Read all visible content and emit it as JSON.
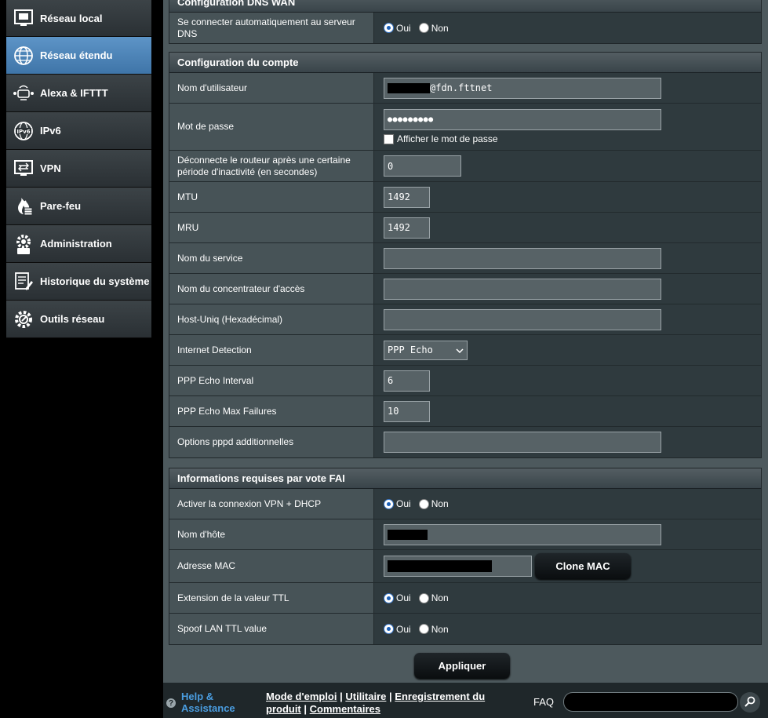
{
  "sidebar": {
    "items": [
      {
        "label": "Réseau local",
        "icon": "lan-icon"
      },
      {
        "label": "Réseau étendu",
        "icon": "wan-globe-icon",
        "active": true
      },
      {
        "label": "Alexa & IFTTT",
        "icon": "alexa-icon"
      },
      {
        "label": "IPv6",
        "icon": "ipv6-icon"
      },
      {
        "label": "VPN",
        "icon": "vpn-icon"
      },
      {
        "label": "Pare-feu",
        "icon": "firewall-icon"
      },
      {
        "label": "Administration",
        "icon": "admin-gear-icon"
      },
      {
        "label": "Historique du système",
        "icon": "log-icon"
      },
      {
        "label": "Outils réseau",
        "icon": "tools-icon"
      }
    ]
  },
  "dns_section": {
    "title": "Configuration DNS WAN",
    "auto_dns_label": "Se connecter automatiquement au serveur DNS",
    "yes": "Oui",
    "no": "Non"
  },
  "account_section": {
    "title": "Configuration du compte",
    "username_label": "Nom d'utilisateur",
    "username_suffix": "@fdn.fttnet",
    "password_label": "Mot de passe",
    "password_value": "●●●●●●●●●",
    "show_password_label": "Afficher le mot de passe",
    "idle_label": "Déconnecte le routeur après une certaine période d'inactivité (en secondes)",
    "idle_value": "0",
    "mtu_label": "MTU",
    "mtu_value": "1492",
    "mru_label": "MRU",
    "mru_value": "1492",
    "service_label": "Nom du service",
    "service_value": "",
    "concentrator_label": "Nom du concentrateur d'accès",
    "concentrator_value": "",
    "hostuniq_label": "Host-Uniq (Hexadécimal)",
    "hostuniq_value": "",
    "detection_label": "Internet Detection",
    "detection_value": "PPP Echo",
    "echo_interval_label": "PPP Echo Interval",
    "echo_interval_value": "6",
    "echo_failures_label": "PPP Echo Max Failures",
    "echo_failures_value": "10",
    "pppd_options_label": "Options pppd additionnelles",
    "pppd_options_value": ""
  },
  "isp_section": {
    "title": "Informations requises par vote FAI",
    "vpn_dhcp_label": "Activer la connexion VPN + DHCP",
    "hostname_label": "Nom d'hôte",
    "mac_label": "Adresse MAC",
    "clone_mac_label": "Clone MAC",
    "ttl_ext_label": "Extension de la valeur TTL",
    "spoof_ttl_label": "Spoof LAN TTL value",
    "yes": "Oui",
    "no": "Non"
  },
  "apply_label": "Appliquer",
  "footer": {
    "help_label": "Help & Assistance",
    "link_manual": "Mode d'emploi",
    "link_utility": "Utilitaire",
    "link_registration": "Enregistrement du produit",
    "link_comments": "Commentaires",
    "separator": "|",
    "faq_label": "FAQ"
  }
}
